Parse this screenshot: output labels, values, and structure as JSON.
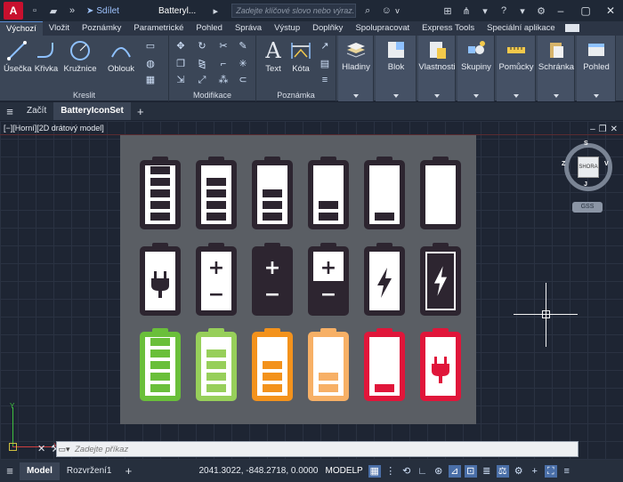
{
  "titlebar": {
    "logo": "A",
    "share_label": "Sdílet",
    "doc_title": "Batteryl...",
    "search_placeholder": "Zadejte klíčové slovo nebo výraz.",
    "user": "v"
  },
  "tabs": [
    "Výchozí",
    "Vložit",
    "Poznámky",
    "Parametrické",
    "Pohled",
    "Správa",
    "Výstup",
    "Doplňky",
    "Spolupracovat",
    "Express Tools",
    "Speciální aplikace"
  ],
  "ribbon": {
    "draw": {
      "label": "Kreslit",
      "buttons": [
        "Úsečka",
        "Křivka",
        "Kružnice",
        "Oblouk"
      ]
    },
    "modify": {
      "label": "Modifikace"
    },
    "annotation": {
      "label": "Poznámka",
      "buttons": [
        "Text",
        "Kóta"
      ]
    },
    "big": [
      "Hladiny",
      "Blok",
      "Vlastnosti",
      "Skupiny",
      "Pomůcky",
      "Schránka",
      "Pohled"
    ]
  },
  "filetabs": {
    "start": "Začít",
    "active": "BatteryIconSet"
  },
  "viewport": {
    "label": "[−][Horní][2D drátový model]",
    "viewcube": {
      "face": "SHORA",
      "n": "S",
      "s": "J",
      "e": "V",
      "w": "Z"
    },
    "gss": "GSS",
    "ucs": {
      "x": "X",
      "y": "Y"
    }
  },
  "battery_rows": [
    [
      {
        "level": 5,
        "color": "#2d2530"
      },
      {
        "level": 4,
        "color": "#2d2530"
      },
      {
        "level": 3,
        "color": "#2d2530"
      },
      {
        "level": 2,
        "color": "#2d2530"
      },
      {
        "level": 1,
        "color": "#2d2530"
      },
      {
        "level": 0,
        "color": "#2d2530"
      }
    ],
    [
      {
        "glyph": "plug-icon",
        "color": "#2d2530"
      },
      {
        "glyph": "plus-minus-icon",
        "color": "#2d2530"
      },
      {
        "glyph": "plus-minus-inverted-icon",
        "color": "#2d2530"
      },
      {
        "glyph": "plus-minus-half-icon",
        "color": "#2d2530"
      },
      {
        "glyph": "bolt-icon",
        "color": "#2d2530"
      },
      {
        "glyph": "bolt-inverted-icon",
        "color": "#2d2530"
      }
    ],
    [
      {
        "level": 5,
        "color": "#6abf3a"
      },
      {
        "level": 4,
        "color": "#97cf5a"
      },
      {
        "level": 3,
        "color": "#f3921c"
      },
      {
        "level": 2,
        "color": "#f7b066"
      },
      {
        "level": 1,
        "color": "#e0163a"
      },
      {
        "glyph": "plug-icon",
        "color": "#e0163a"
      }
    ]
  ],
  "command": {
    "placeholder": "Zadejte příkaz"
  },
  "status": {
    "model_tab": "Model",
    "layout_tab": "Rozvržení1",
    "coords": "2041.3022, -848.2718, 0.0000",
    "mode": "MODELP"
  }
}
